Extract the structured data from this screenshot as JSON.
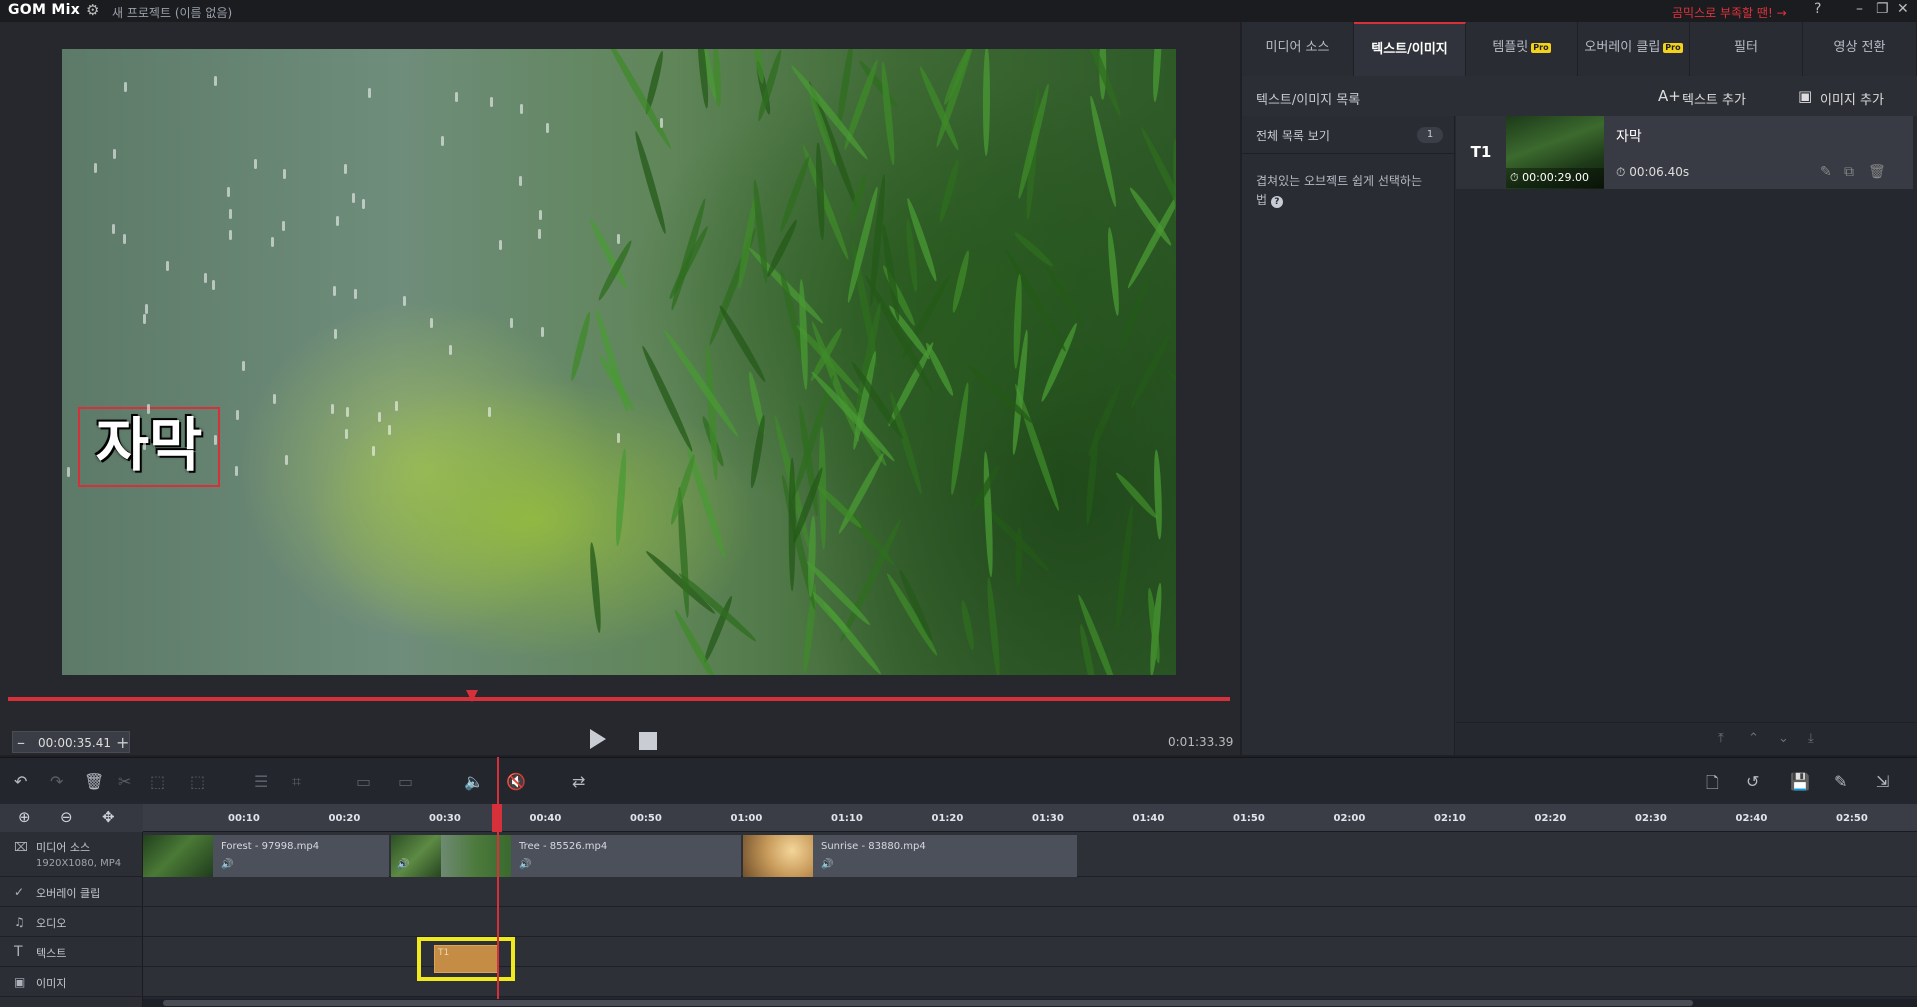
{
  "app": {
    "logo": "GOM Mix",
    "project_title": "새 프로젝트 (이름 없음)",
    "promo_link": "곰믹스로 부족할 땐! →",
    "help": "?",
    "min": "–",
    "restore": "❐",
    "close": "✕"
  },
  "preview": {
    "caption_text": "자막",
    "current_time": "00:00:35.41",
    "total_time": "0:01:33.39",
    "minus": "–",
    "plus": "+",
    "playhead_fraction": 0.38,
    "accent_color": "#d6313a"
  },
  "tabs": [
    {
      "label": "미디어 소스",
      "pro": false
    },
    {
      "label": "텍스트/이미지",
      "pro": false,
      "active": true
    },
    {
      "label": "템플릿",
      "pro": true
    },
    {
      "label": "오버레이 클립",
      "pro": true
    },
    {
      "label": "필터",
      "pro": false
    },
    {
      "label": "영상 전환",
      "pro": false
    }
  ],
  "pro_badge": "Pro",
  "text_image_panel": {
    "list_title": "텍스트/이미지 목록",
    "add_text": "텍스트 추가",
    "add_image": "이미지 추가",
    "view_all": "전체 목록 보기",
    "count": "1",
    "hint": "겹쳐있는 오브젝트 쉽게 선택하는 법",
    "hint_icon": "?",
    "item": {
      "badge": "T1",
      "start_time": "00:00:29.00",
      "name": "자막",
      "duration": "00:06.40s"
    }
  },
  "timeline": {
    "ruler_ticks": [
      "00:10",
      "00:20",
      "00:30",
      "00:40",
      "00:50",
      "01:00",
      "01:10",
      "01:20",
      "01:30",
      "01:40",
      "01:50",
      "02:00",
      "02:10",
      "02:20",
      "02:30",
      "02:40",
      "02:50"
    ],
    "tracks": [
      {
        "name": "미디어 소스",
        "sub": "1920X1080, MP4",
        "icon": "film-icon"
      },
      {
        "name": "오버레이 클립",
        "icon": "overlay-icon"
      },
      {
        "name": "오디오",
        "icon": "music-icon"
      },
      {
        "name": "텍스트",
        "icon": "text-icon"
      },
      {
        "name": "이미지",
        "icon": "image-icon"
      }
    ],
    "clips": [
      {
        "label": "Forest - 97998.mp4"
      },
      {
        "label": "Tree - 85526.mp4"
      },
      {
        "label": "Sunrise - 83880.mp4"
      }
    ],
    "text_clip_label": "T1"
  }
}
